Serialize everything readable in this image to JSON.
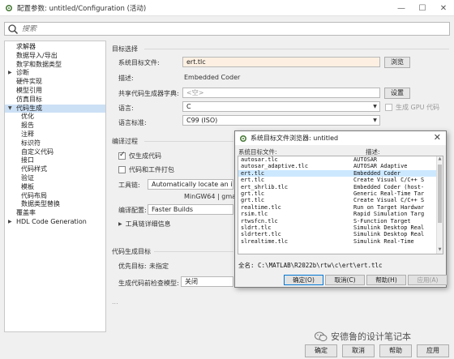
{
  "window": {
    "title": "配置参数: untitled/Configuration (活动)",
    "icons": {
      "app": "gear-icon",
      "minimize": "minimize-icon",
      "maximize": "maximize-icon",
      "close": "close-icon"
    }
  },
  "search": {
    "placeholder": "搜索"
  },
  "tree": {
    "items": [
      {
        "label": "求解器",
        "level": 0,
        "arrow": ""
      },
      {
        "label": "数据导入/导出",
        "level": 0,
        "arrow": ""
      },
      {
        "label": "数学和数据类型",
        "level": 0,
        "arrow": ""
      },
      {
        "label": "诊断",
        "level": 0,
        "arrow": "▶"
      },
      {
        "label": "硬件实现",
        "level": 0,
        "arrow": ""
      },
      {
        "label": "模型引用",
        "level": 0,
        "arrow": ""
      },
      {
        "label": "仿真目标",
        "level": 0,
        "arrow": ""
      },
      {
        "label": "代码生成",
        "level": 0,
        "arrow": "▼",
        "selected": true
      },
      {
        "label": "优化",
        "level": 1,
        "arrow": ""
      },
      {
        "label": "报告",
        "level": 1,
        "arrow": ""
      },
      {
        "label": "注释",
        "level": 1,
        "arrow": ""
      },
      {
        "label": "标识符",
        "level": 1,
        "arrow": ""
      },
      {
        "label": "自定义代码",
        "level": 1,
        "arrow": ""
      },
      {
        "label": "接口",
        "level": 1,
        "arrow": ""
      },
      {
        "label": "代码样式",
        "level": 1,
        "arrow": ""
      },
      {
        "label": "验证",
        "level": 1,
        "arrow": ""
      },
      {
        "label": "模板",
        "level": 1,
        "arrow": ""
      },
      {
        "label": "代码布局",
        "level": 1,
        "arrow": ""
      },
      {
        "label": "数据类型替换",
        "level": 1,
        "arrow": ""
      },
      {
        "label": "覆盖率",
        "level": 0,
        "arrow": ""
      },
      {
        "label": "HDL Code Generation",
        "level": 0,
        "arrow": "▶"
      }
    ]
  },
  "target_selection": {
    "heading": "目标选择",
    "system_target_label": "系统目标文件:",
    "system_target_value": "ert.tlc",
    "browse_label": "浏览",
    "description_label": "描述:",
    "description_value": "Embedded Coder",
    "shared_lib_label": "共享代码生成器字典:",
    "shared_lib_value": "<空>",
    "settings_label": "设置",
    "language_label": "语言:",
    "language_value": "C",
    "gpu_label": "生成 GPU 代码",
    "standard_label": "语言标准:",
    "standard_value": "C99 (ISO)"
  },
  "build_process": {
    "heading": "编译过程",
    "generate_code_only": "仅生成代码",
    "package_code": "代码和工件打包",
    "toolchain_label": "工具链:",
    "toolchain_value": "Automatically locate an insta",
    "toolchain_detail": "MinGW64 | gmake (64-bit Wi",
    "build_config_label": "编译配置:",
    "build_config_value": "Faster Builds",
    "toolchain_details_label": "工具链详细信息"
  },
  "codegen_objectives": {
    "heading": "代码生成目标",
    "priority_label": "优先目标:",
    "priority_value": "未指定",
    "check_model_label": "生成代码前检查模型:",
    "check_model_value": "关闭",
    "more": "..."
  },
  "dialog": {
    "title": "系统目标文件浏览器: untitled",
    "col_file": "系统目标文件:",
    "col_desc": "描述:",
    "rows": [
      {
        "file": "autosar.tlc",
        "desc": "AUTOSAR"
      },
      {
        "file": "autosar_adaptive.tlc",
        "desc": "AUTOSAR Adaptive"
      },
      {
        "file": "ert.tlc",
        "desc": "Embedded Coder",
        "selected": true
      },
      {
        "file": "ert.tlc",
        "desc": "Create Visual C/C++ S"
      },
      {
        "file": "ert_shrlib.tlc",
        "desc": "Embedded Coder (host-"
      },
      {
        "file": "grt.tlc",
        "desc": "Generic Real-Time Tar"
      },
      {
        "file": "grt.tlc",
        "desc": "Create Visual C/C++ S"
      },
      {
        "file": "realtime.tlc",
        "desc": "Run on Target Hardwar"
      },
      {
        "file": "rsim.tlc",
        "desc": "Rapid Simulation Targ"
      },
      {
        "file": "rtwsfcn.tlc",
        "desc": "S-Function Target"
      },
      {
        "file": "sldrt.tlc",
        "desc": "Simulink Desktop Real"
      },
      {
        "file": "sldrtert.tlc",
        "desc": "Simulink Desktop Real"
      },
      {
        "file": "slrealtime.tlc",
        "desc": "Simulink Real-Time"
      }
    ],
    "full_name": "全名: C:\\MATLAB\\R2022b\\rtw\\c\\ert\\ert.tlc",
    "ok": "确定(O)",
    "cancel": "取消(C)",
    "help": "帮助(H)",
    "apply": "应用(A)"
  },
  "bottom": {
    "ok": "确定",
    "cancel": "取消",
    "help": "帮助",
    "apply": "应用"
  },
  "watermark": {
    "text": "安德鲁的设计笔记本",
    "icon": "wechat-icon"
  }
}
